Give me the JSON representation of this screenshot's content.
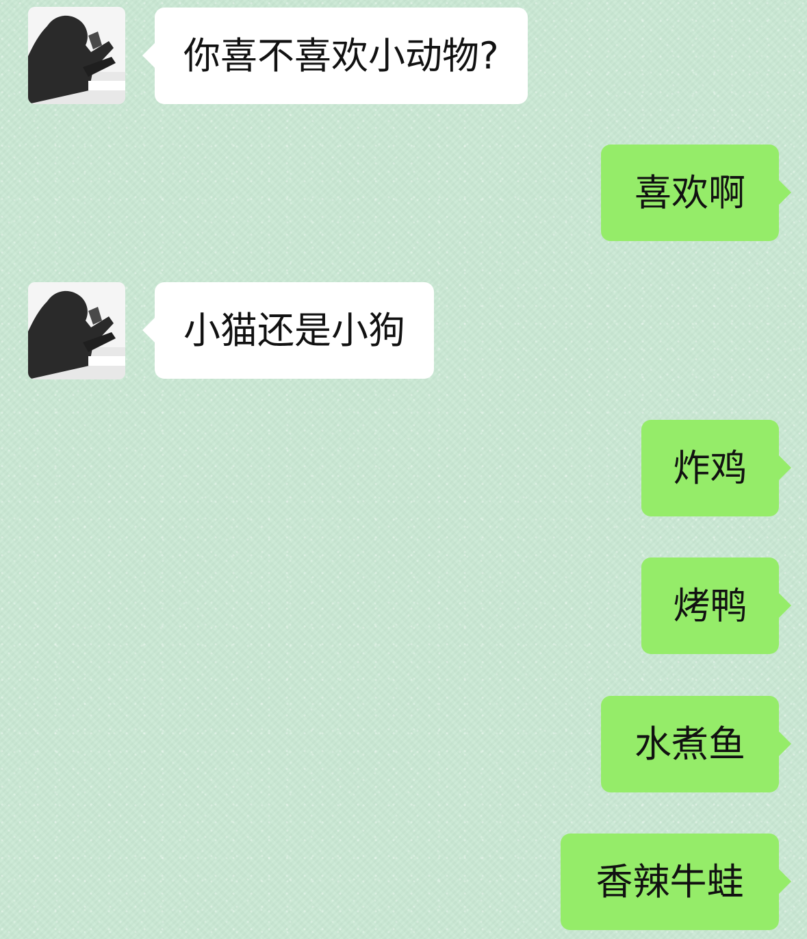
{
  "messages": [
    {
      "side": "left",
      "text": "你喜不喜欢小动物?"
    },
    {
      "side": "right",
      "text": "喜欢啊"
    },
    {
      "side": "left",
      "text": "小猫还是小狗"
    },
    {
      "side": "right",
      "text": "炸鸡"
    },
    {
      "side": "right",
      "text": "烤鸭"
    },
    {
      "side": "right",
      "text": "水煮鱼"
    },
    {
      "side": "right",
      "text": "香辣牛蛙"
    }
  ],
  "colors": {
    "background": "#c9e8d3",
    "incoming_bubble": "#ffffff",
    "outgoing_bubble": "#95ec69",
    "text": "#111111"
  },
  "icons": {
    "avatar": "avatar-icon"
  }
}
